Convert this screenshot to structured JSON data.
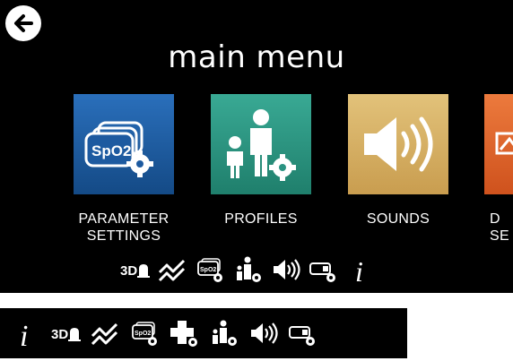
{
  "header": {
    "title": "main menu",
    "back_icon": "back-arrow-icon"
  },
  "tiles": [
    {
      "label_line1": "PARAMETER",
      "label_line2": "SETTINGS",
      "icon": "spo2-settings-icon",
      "color": "#1f5fa6"
    },
    {
      "label_line1": "PROFILES",
      "label_line2": "",
      "icon": "profiles-icon",
      "color": "#2f9a87"
    },
    {
      "label_line1": "SOUNDS",
      "label_line2": "",
      "icon": "speaker-icon",
      "color": "#d7b266"
    },
    {
      "label_line1": "D",
      "label_line2": "SE",
      "icon": "display-icon",
      "color": "#e0642a"
    }
  ],
  "toolbar_top": [
    "3d-alarm-icon",
    "trends-icon",
    "spo2-settings-icon",
    "profiles-icon",
    "sound-icon",
    "sensor-settings-icon",
    "info-icon"
  ],
  "toolbar_bottom": [
    "info-icon",
    "3d-alarm-icon",
    "trends-icon",
    "spo2-settings-icon",
    "medical-cross-icon",
    "profiles-icon",
    "sound-icon",
    "sensor-settings-icon"
  ],
  "text": {
    "threed": "3D",
    "spo2": "SpO2",
    "info": "i"
  }
}
